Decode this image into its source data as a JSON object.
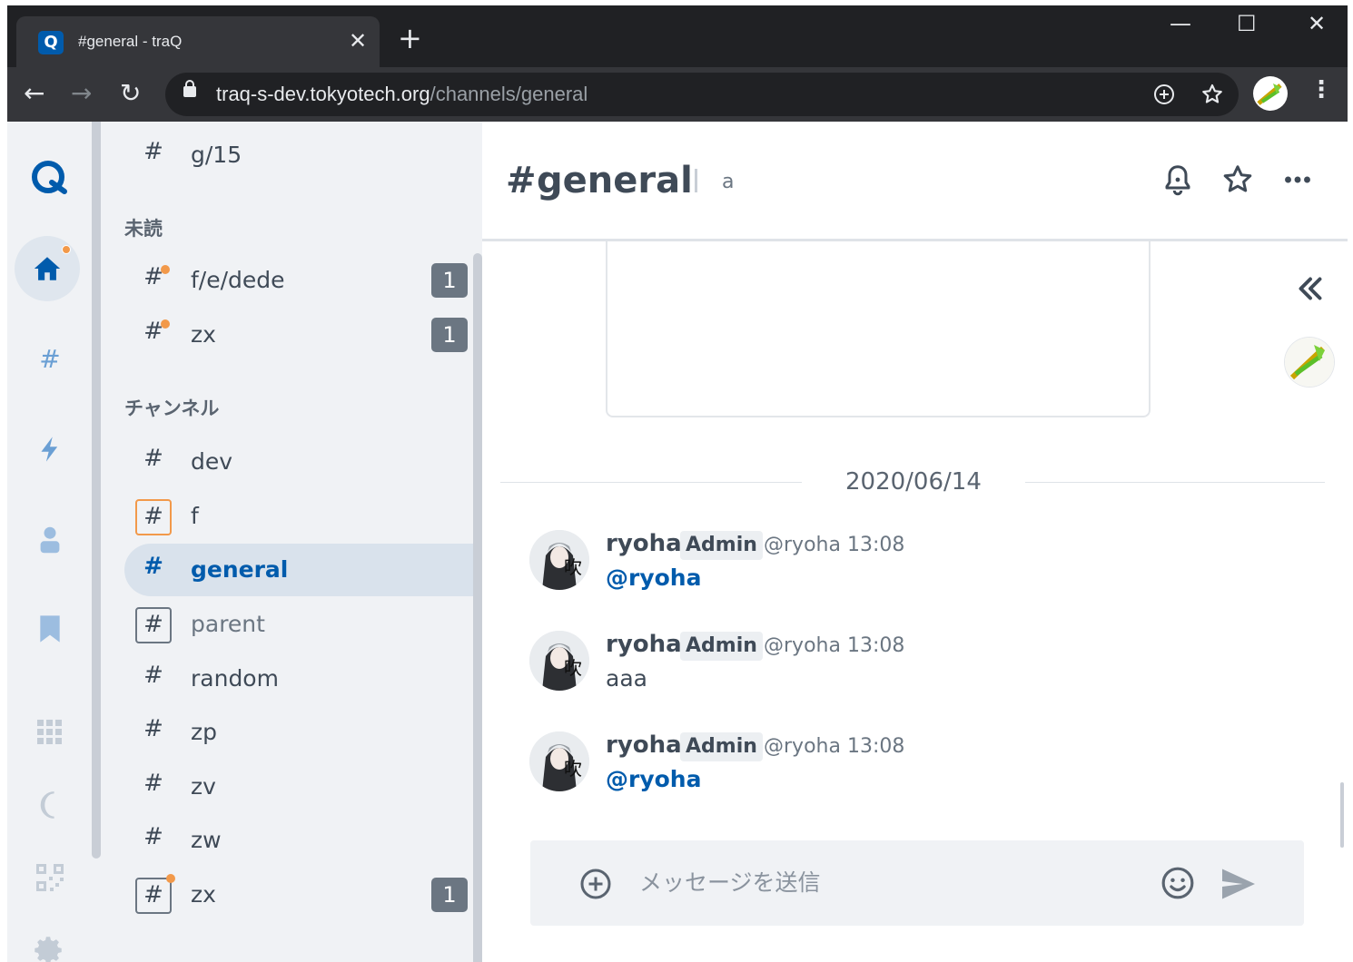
{
  "browser": {
    "tab_title": "#general - traQ",
    "tab_close": "✕",
    "new_tab": "+",
    "url_host": "traq-s-dev.tokyotech.org",
    "url_path": "/channels/general",
    "window_minimize": "—",
    "window_maximize": "☐",
    "window_close": "✕",
    "back": "←",
    "forward": "→",
    "reload": "↻"
  },
  "sidebar": {
    "top_channel": {
      "hash": "#",
      "name": "g/15"
    },
    "unread_title": "未読",
    "unread": [
      {
        "hash": "#",
        "name": "f/e/dede",
        "badge": "1"
      },
      {
        "hash": "#",
        "name": "zx",
        "badge": "1"
      }
    ],
    "channels_title": "チャンネル",
    "channels": [
      {
        "hash": "#",
        "name": "dev"
      },
      {
        "hash": "#",
        "name": "f"
      },
      {
        "hash": "#",
        "name": "general"
      },
      {
        "hash": "#",
        "name": "parent"
      },
      {
        "hash": "#",
        "name": "random"
      },
      {
        "hash": "#",
        "name": "zp"
      },
      {
        "hash": "#",
        "name": "zv"
      },
      {
        "hash": "#",
        "name": "zw"
      },
      {
        "hash": "#",
        "name": "zx",
        "badge": "1"
      }
    ]
  },
  "header": {
    "hash": "#",
    "title": "general",
    "topic": "a"
  },
  "timeline": {
    "date": "2020/06/14",
    "messages": [
      {
        "user": "ryoha",
        "badge": "Admin",
        "handle": "@ryoha",
        "time": "13:08",
        "body": "@ryoha"
      },
      {
        "user": "ryoha",
        "badge": "Admin",
        "handle": "@ryoha",
        "time": "13:08",
        "body": "aaa"
      },
      {
        "user": "ryoha",
        "badge": "Admin",
        "handle": "@ryoha",
        "time": "13:08",
        "body": "@ryoha"
      }
    ]
  },
  "composer": {
    "placeholder": "メッセージを送信"
  },
  "colors": {
    "accent": "#005bac",
    "unread_dot": "#f2994a",
    "chrome_dark": "#202124",
    "sidebar_bg": "#f0f2f5"
  }
}
